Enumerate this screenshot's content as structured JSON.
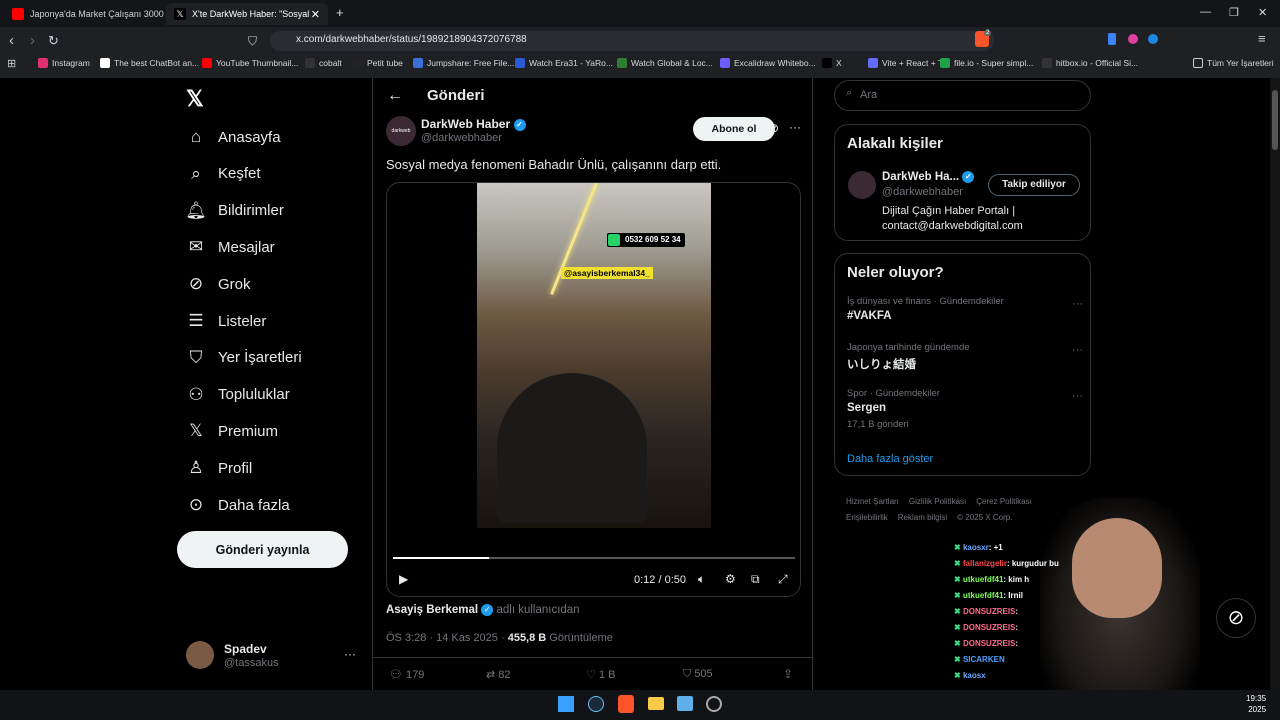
{
  "browser": {
    "tabs": [
      {
        "title": "Japonya'da Market Çalışanı 3000 Dol"
      },
      {
        "title": "X'te DarkWeb Haber: \"Sosyal"
      }
    ],
    "url": "x.com/darkwebhaber/status/1989218904372076788",
    "bookmarks": [
      "Instagram",
      "The best ChatBot an...",
      "YouTube Thumbnail...",
      "cobalt",
      "Petit tube",
      "Jumpshare: Free File...",
      "Watch Era31 - YaRo...",
      "Watch Global & Loc...",
      "Excalidraw Whitebo...",
      "X",
      "Vite + React + TS",
      "file.io - Super simpl...",
      "hitbox.io - Official Si..."
    ],
    "bookmarks_folder": "Tüm Yer İşaretleri",
    "badge_count": "2"
  },
  "nav": {
    "items": [
      "Anasayfa",
      "Keşfet",
      "Bildirimler",
      "Mesajlar",
      "Grok",
      "Listeler",
      "Yer İşaretleri",
      "Topluluklar",
      "Premium",
      "Profil",
      "Daha fazla"
    ],
    "post_button": "Gönderi yayınla",
    "user_name": "Spadev",
    "user_handle": "@tassakus"
  },
  "post": {
    "header": "Gönderi",
    "author": "DarkWeb Haber",
    "handle": "@darkwebhaber",
    "subscribe": "Abone ol",
    "text": "Sosyal medya fenomeni Bahadır Ünlü, çalışanını darp etti.",
    "video_phone": "0532 609 52 34",
    "video_tag": "@asayisberkemal34_",
    "video_time": "0:12 / 0:50",
    "video_progress": 0.24,
    "credit_name": "Asayiş Berkemal",
    "credit_suffix": "adlı kullanıcıdan",
    "timestamp": "ÖS 3:28 · 14 Kas 2025 ·",
    "views": "455,8 B",
    "views_label": "Görüntüleme",
    "replies": "179",
    "reposts": "82",
    "likes": "1 B",
    "bookmarks": "505"
  },
  "right": {
    "search_placeholder": "Ara",
    "related_title": "Alakalı kişiler",
    "related_name": "DarkWeb Ha...",
    "related_handle": "@darkwebhaber",
    "related_follow": "Takip ediliyor",
    "related_bio_1": "Dijital Çağın Haber Portalı |",
    "related_bio_2": "contact@darkwebdigital.com",
    "trends_title": "Neler oluyor?",
    "trends": [
      {
        "meta": "İş dünyası ve finans · Gündemdekiler",
        "name": "#VAKFA",
        "count": ""
      },
      {
        "meta": "Japonya tarihinde gündemde",
        "name": "いしりょ結婚",
        "count": ""
      },
      {
        "meta": "Spor · Gündemdekiler",
        "name": "Sergen",
        "count": "17,1 B gönderi"
      }
    ],
    "show_more": "Daha fazla göster",
    "footer": [
      "Hizmet Şartları",
      "Gizlilik Politikası",
      "Çerez Politikası",
      "Erişilebilirlik",
      "Reklam bilgisi",
      "© 2025 X Corp."
    ]
  },
  "chat": [
    {
      "user": "kaosxr",
      "msg": ": +1",
      "color": "#6aa7ff"
    },
    {
      "user": "fallanizgelir",
      "msg": ": kurgudur bu",
      "color": "#ff4a4a"
    },
    {
      "user": "utkuefdf41",
      "msg": ": kim h",
      "color": "#7cff5a"
    },
    {
      "user": "utkuefdf41",
      "msg": ": Irnil",
      "color": "#7cff5a"
    },
    {
      "user": "DONSUZREIS",
      "msg": ":",
      "color": "#ff6a8a"
    },
    {
      "user": "DONSUZREIS",
      "msg": ":",
      "color": "#ff6a8a"
    },
    {
      "user": "DONSUZREIS",
      "msg": ":",
      "color": "#ff6a8a"
    },
    {
      "user": "SICARKEN",
      "msg": "",
      "color": "#4aa0ff"
    },
    {
      "user": "kaosx",
      "msg": "",
      "color": "#6aa7ff"
    }
  ],
  "clock": {
    "time": "19:35",
    "year": "2025"
  }
}
